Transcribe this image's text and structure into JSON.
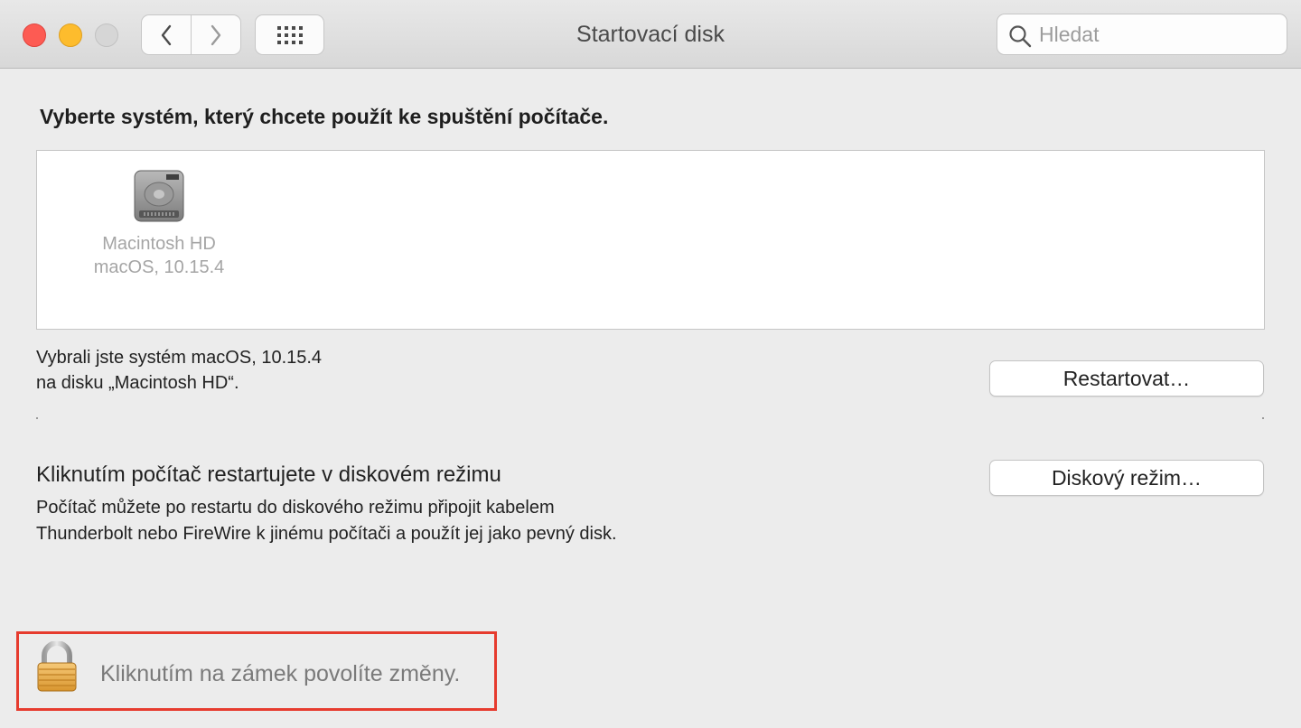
{
  "window": {
    "title": "Startovací disk",
    "search_placeholder": "Hledat"
  },
  "main": {
    "heading": "Vyberte systém, který chcete použít ke spuštění počítače.",
    "disks": [
      {
        "name": "Macintosh HD",
        "system": "macOS, 10.15.4"
      }
    ],
    "selection_line1": "Vybrali jste systém macOS, 10.15.4",
    "selection_line2": "na disku „Macintosh HD“.",
    "restart_button": "Restartovat…",
    "target_disk_title": "Kliknutím počítač restartujete v diskovém režimu",
    "target_disk_desc_line1": "Počítač můžete po restartu do diskového režimu připojit kabelem",
    "target_disk_desc_line2": "Thunderbolt nebo FireWire k jinému počítači a použít jej jako pevný disk.",
    "disk_mode_button": "Diskový režim…"
  },
  "footer": {
    "lock_text": "Kliknutím na zámek povolíte změny."
  },
  "colors": {
    "highlight_border": "#e63b2e",
    "close": "#fd5b53",
    "minimize": "#fdbc2d"
  }
}
